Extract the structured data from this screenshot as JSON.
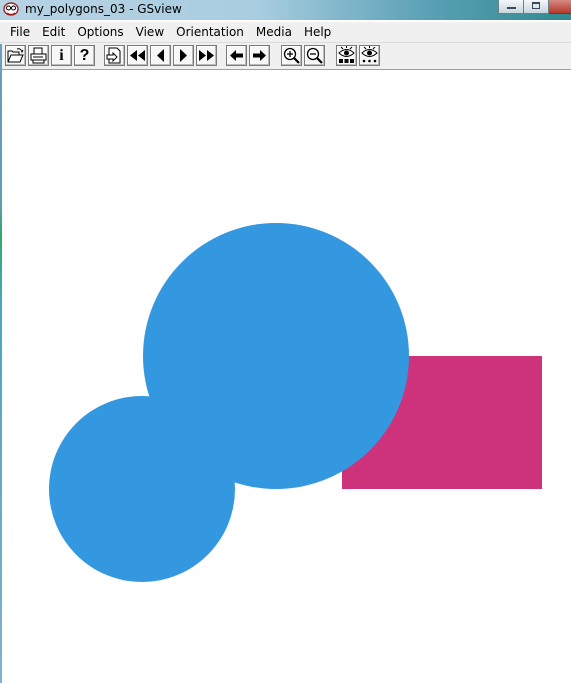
{
  "window": {
    "title": "my_polygons_03 - GSview",
    "app_icon": "gsview-ghost-icon"
  },
  "menu": {
    "items": [
      "File",
      "Edit",
      "Options",
      "View",
      "Orientation",
      "Media",
      "Help"
    ]
  },
  "toolbar": {
    "buttons": [
      {
        "name": "open-file-button",
        "icon": "open-folder-icon"
      },
      {
        "name": "print-button",
        "icon": "printer-icon"
      },
      {
        "name": "info-button",
        "icon": "info-icon",
        "glyph": "i"
      },
      {
        "name": "help-button",
        "icon": "help-icon",
        "glyph": "?"
      },
      {
        "name": "goto-page-button",
        "icon": "goto-page-icon"
      },
      {
        "name": "first-page-button",
        "icon": "double-left-arrow-icon"
      },
      {
        "name": "previous-page-button",
        "icon": "left-triangle-icon"
      },
      {
        "name": "next-page-button",
        "icon": "right-triangle-icon"
      },
      {
        "name": "last-page-button",
        "icon": "double-right-arrow-icon"
      },
      {
        "name": "back-button",
        "icon": "left-arrow-icon"
      },
      {
        "name": "forward-button",
        "icon": "right-arrow-icon"
      },
      {
        "name": "zoom-in-button",
        "icon": "zoom-in-icon"
      },
      {
        "name": "zoom-out-button",
        "icon": "zoom-out-icon"
      },
      {
        "name": "find-text-button",
        "icon": "eye-abc-icon"
      },
      {
        "name": "find-next-button",
        "icon": "eye-dots-icon"
      }
    ]
  },
  "document": {
    "colors": {
      "circle": "#3398e0",
      "rectangle": "#cc337a",
      "background": "#ffffff"
    },
    "shapes": [
      "large-circle",
      "small-circle",
      "rectangle"
    ]
  }
}
